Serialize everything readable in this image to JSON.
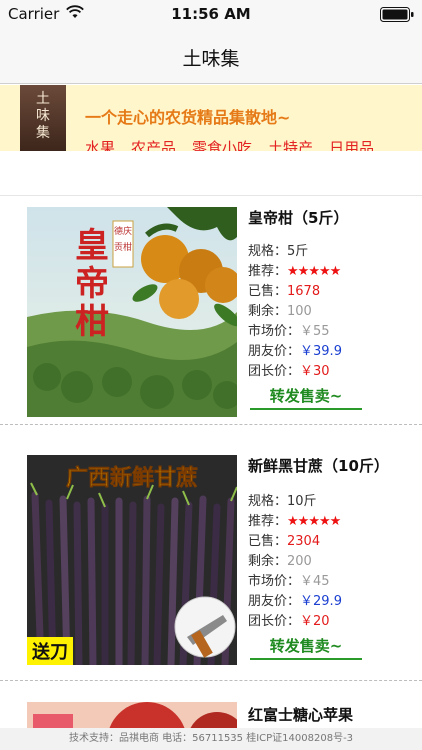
{
  "status": {
    "carrier": "Carrier",
    "time": "11:56 AM"
  },
  "nav": {
    "title": "土味集"
  },
  "banner": {
    "logo_text": [
      "土",
      "味",
      "集"
    ],
    "tagline": "一个走心的农货精品集散地~",
    "categories": [
      "水果",
      "农产品",
      "零食小吃",
      "土特产",
      "日用品"
    ]
  },
  "labels": {
    "spec": "规格：",
    "recommend": "推荐：",
    "sold": "已售：",
    "remain": "剩余：",
    "market": "市场价：",
    "friend": "朋友价：",
    "leader": "团长价：",
    "forward": "转发售卖~"
  },
  "products": [
    {
      "name": "皇帝柑（5斤）",
      "spec": "5斤",
      "stars": "★★★★★",
      "sold": "1678",
      "remain": "100",
      "market": "￥55",
      "friend": "￥39.9",
      "leader": "￥30",
      "image_text": {
        "big": "皇帝柑",
        "badge": "德庆贡柑"
      }
    },
    {
      "name": "新鲜黑甘蔗（10斤）",
      "spec": "10斤",
      "stars": "★★★★★",
      "sold": "2304",
      "remain": "200",
      "market": "￥45",
      "friend": "￥29.9",
      "leader": "￥20",
      "image_text": {
        "big": "广西新鲜甘蔗",
        "badge": "送刀"
      }
    },
    {
      "name": "红富士糖心苹果"
    }
  ],
  "footer": {
    "text": "技术支持：品祺电商   电话：56711535   桂ICP证14008208号-3"
  },
  "colors": {
    "accent_red": "#e31b1b",
    "accent_orange": "#e57a17",
    "forward_green": "#1f8a1f",
    "banner_bg": "#fff6cc"
  }
}
